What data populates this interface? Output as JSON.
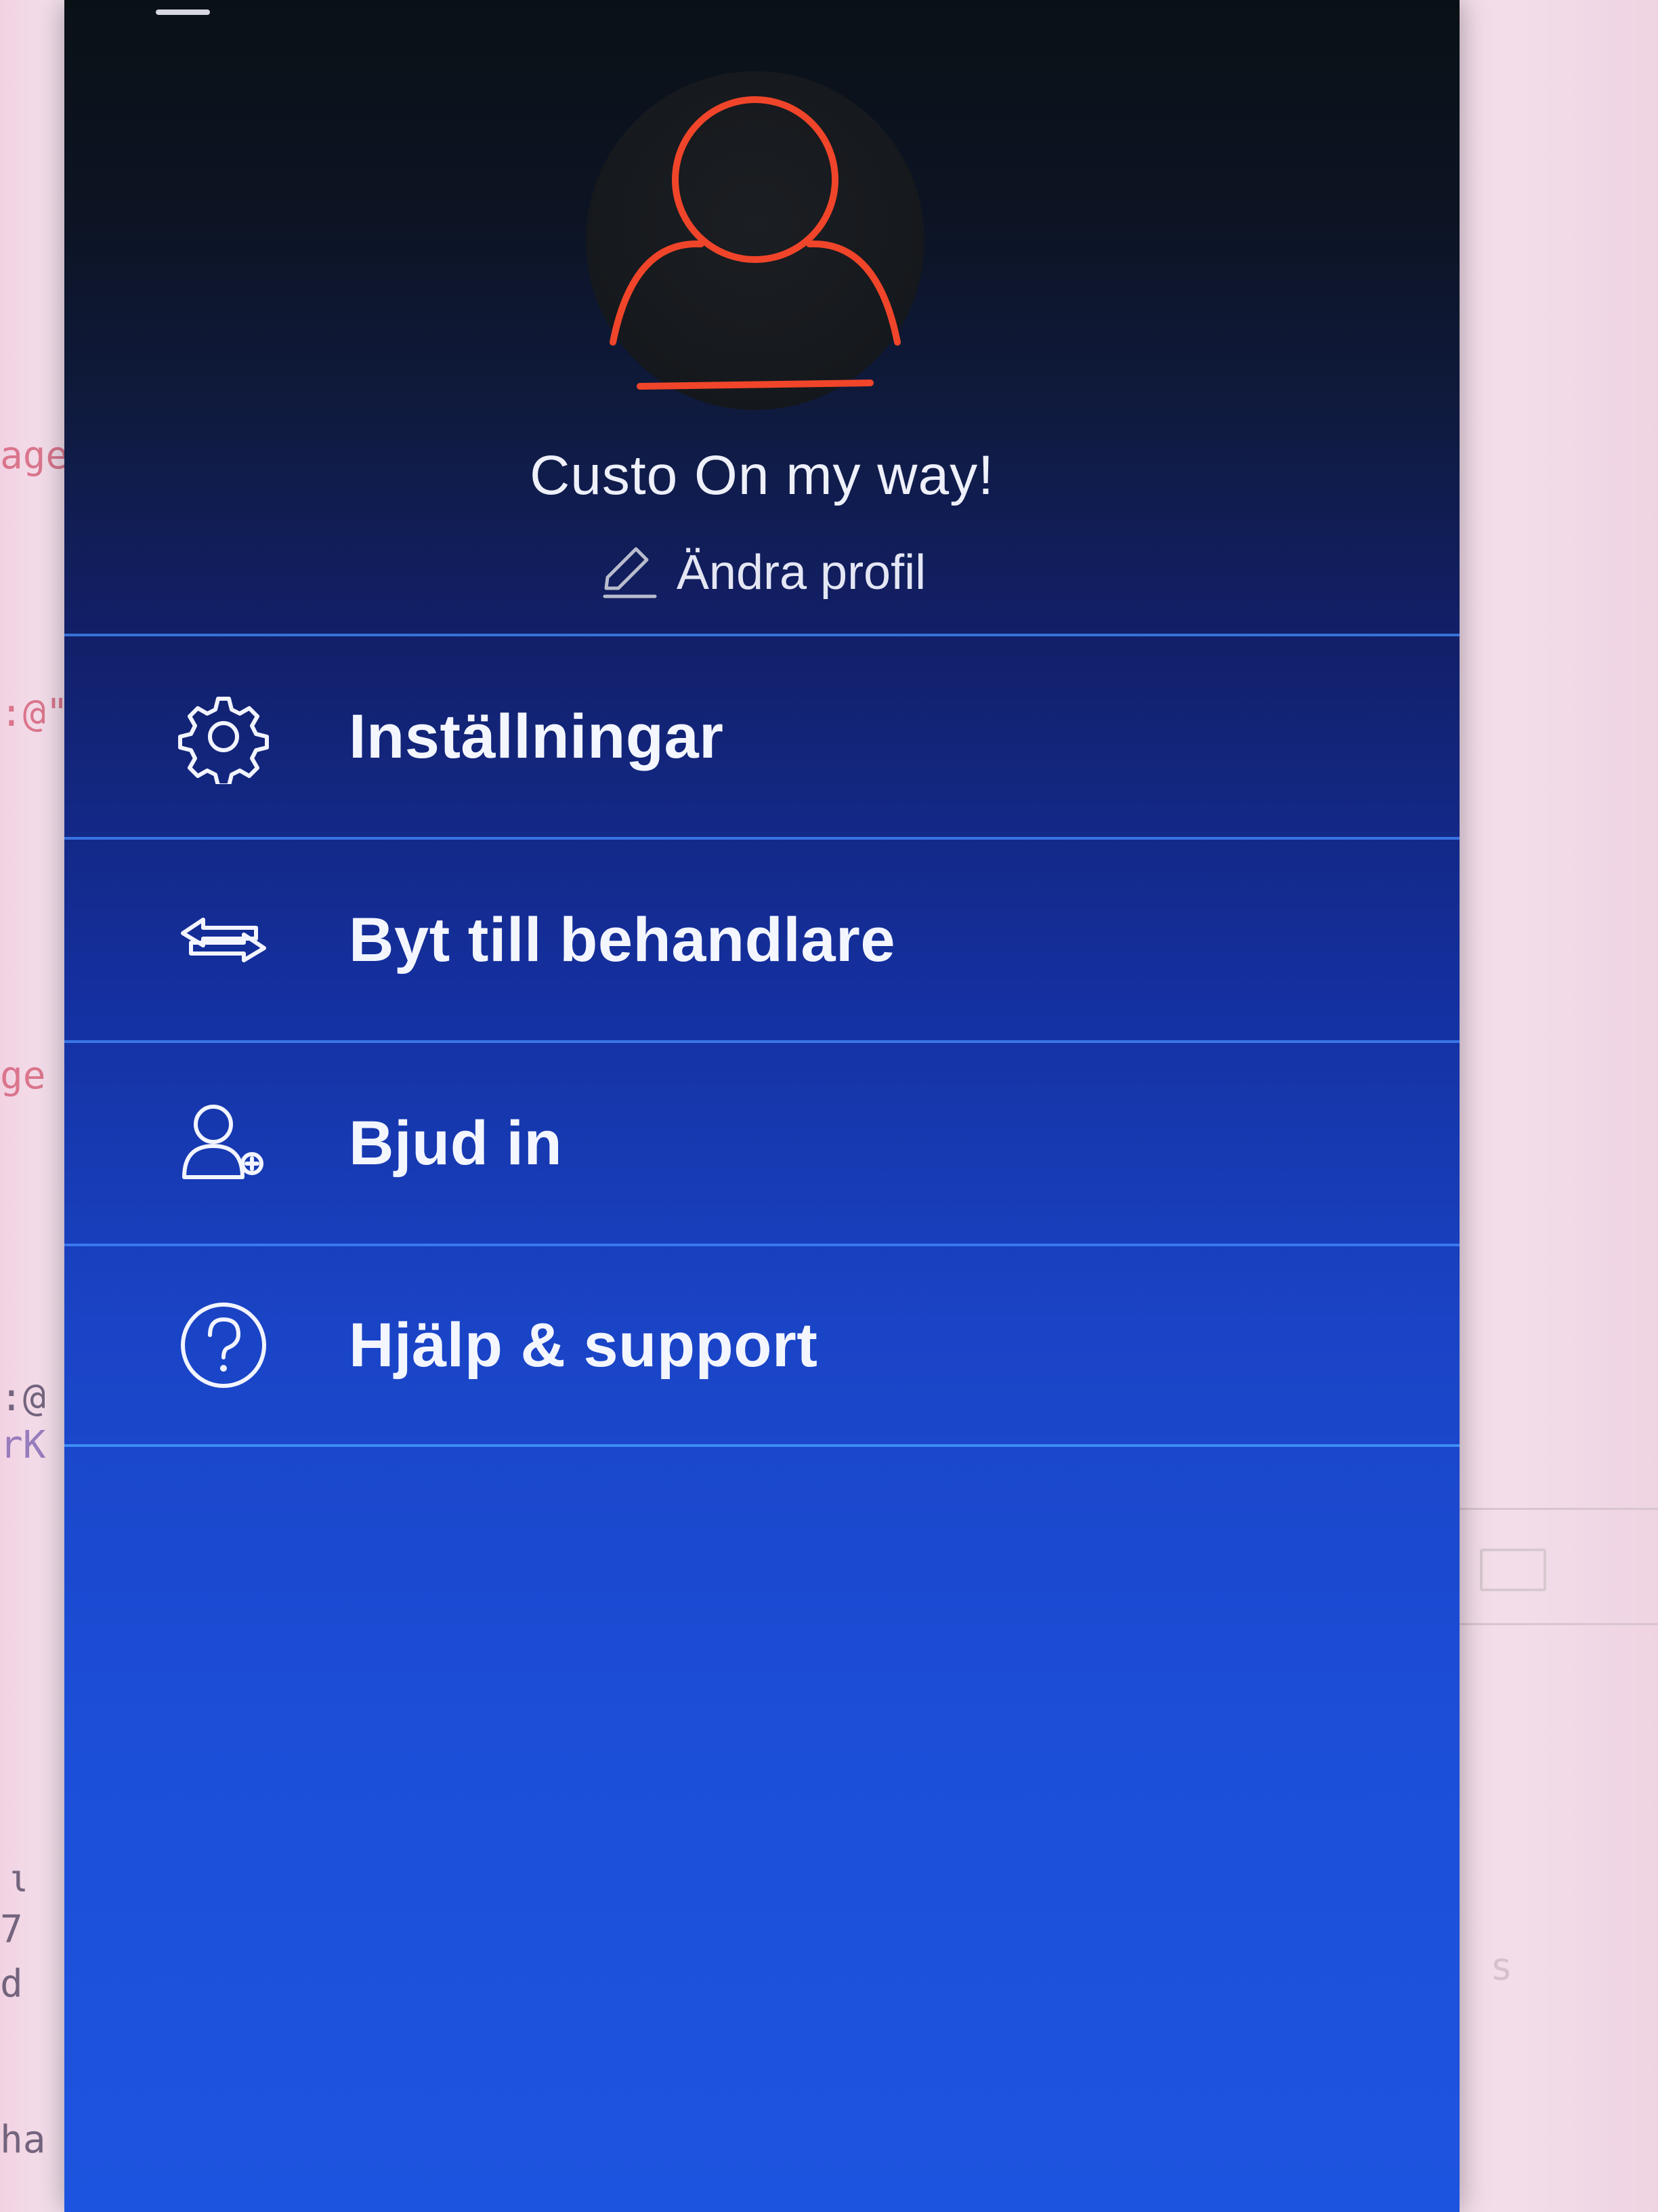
{
  "profile": {
    "name": "Custo On my way!",
    "edit_label": "Ändra profil",
    "accent_color": "#f0452a"
  },
  "menu": {
    "items": [
      {
        "label": "Inställningar",
        "icon": "gear-icon"
      },
      {
        "label": "Byt till behandlare",
        "icon": "swap-arrows-icon"
      },
      {
        "label": "Bjud in",
        "icon": "add-user-icon"
      },
      {
        "label": "Hjälp & support",
        "icon": "help-circle-icon"
      }
    ]
  },
  "background": {
    "fragments": [
      "age",
      ":@\"",
      "ge",
      ":@",
      "rK",
      "ι",
      "7",
      "d",
      "ha",
      "s"
    ]
  },
  "colors": {
    "drawer_top": "#0a1116",
    "drawer_bottom": "#1d54df",
    "divider": "#468cff",
    "text": "#f4f6ff"
  }
}
